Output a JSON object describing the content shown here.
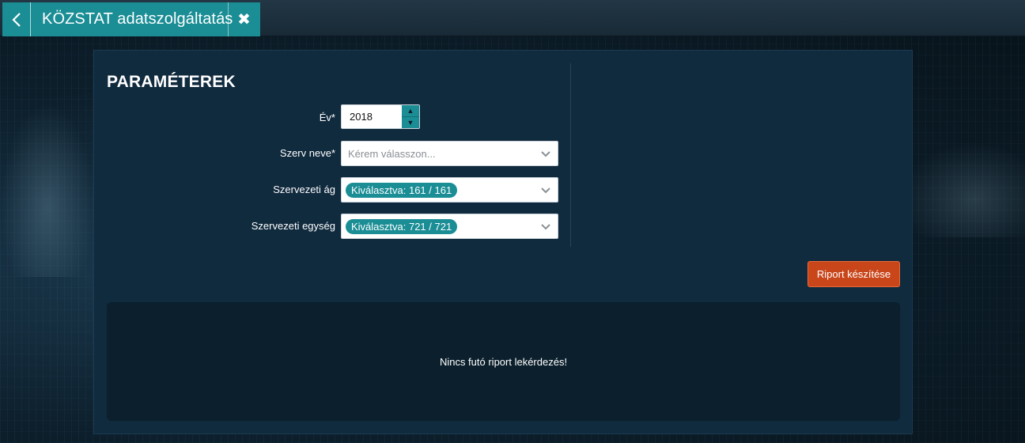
{
  "window": {
    "title": "KÖZSTAT adatszolgáltatás"
  },
  "panel": {
    "title": "PARAMÉTEREK",
    "fields": {
      "year": {
        "label": "Év*",
        "value": "2018"
      },
      "org_name": {
        "label": "Szerv neve*",
        "placeholder": "Kérem válasszon..."
      },
      "org_branch": {
        "label": "Szervezeti ág",
        "selected": "Kiválasztva: 161 / 161"
      },
      "org_unit": {
        "label": "Szervezeti egység",
        "selected": "Kiválasztva: 721 / 721"
      }
    },
    "report_button": "Riport készítése",
    "result_message": "Nincs futó riport lekérdezés!"
  },
  "colors": {
    "accent_teal": "#1a8d95",
    "button_orange": "#c9461b",
    "panel_bg": "#102a3e"
  }
}
